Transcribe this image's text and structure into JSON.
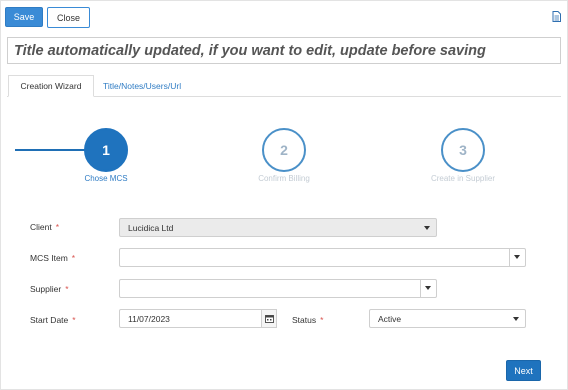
{
  "toolbar": {
    "save_label": "Save",
    "close_label": "Close",
    "document_icon": "document-icon"
  },
  "title_field": {
    "value": "Title automatically updated, if you want to edit, update before saving"
  },
  "tabs": [
    {
      "label": "Creation Wizard",
      "active": true
    },
    {
      "label": "Title/Notes/Users/Url",
      "active": false
    }
  ],
  "wizard": {
    "steps": [
      {
        "number": "1",
        "label": "Chose MCS",
        "state": "current"
      },
      {
        "number": "2",
        "label": "Confirm Billing",
        "state": "upcoming"
      },
      {
        "number": "3",
        "label": "Create in Supplier",
        "state": "upcoming"
      }
    ]
  },
  "form": {
    "client": {
      "label": "Client",
      "required_marker": "*",
      "value": "Lucidica Ltd",
      "disabled": true
    },
    "mcs_item": {
      "label": "MCS Item",
      "required_marker": "*",
      "value": ""
    },
    "supplier": {
      "label": "Supplier",
      "required_marker": "*",
      "value": ""
    },
    "start_date": {
      "label": "Start Date",
      "required_marker": "*",
      "value": "11/07/2023",
      "icon": "calendar-icon"
    },
    "status": {
      "label": "Status",
      "required_marker": "*",
      "value": "Active"
    }
  },
  "footer": {
    "next_label": "Next"
  },
  "colors": {
    "primary": "#1f73be",
    "required": "#d9534f",
    "tab_link": "#2f7cc4",
    "inactive_step_label": "#c4ccd4"
  }
}
